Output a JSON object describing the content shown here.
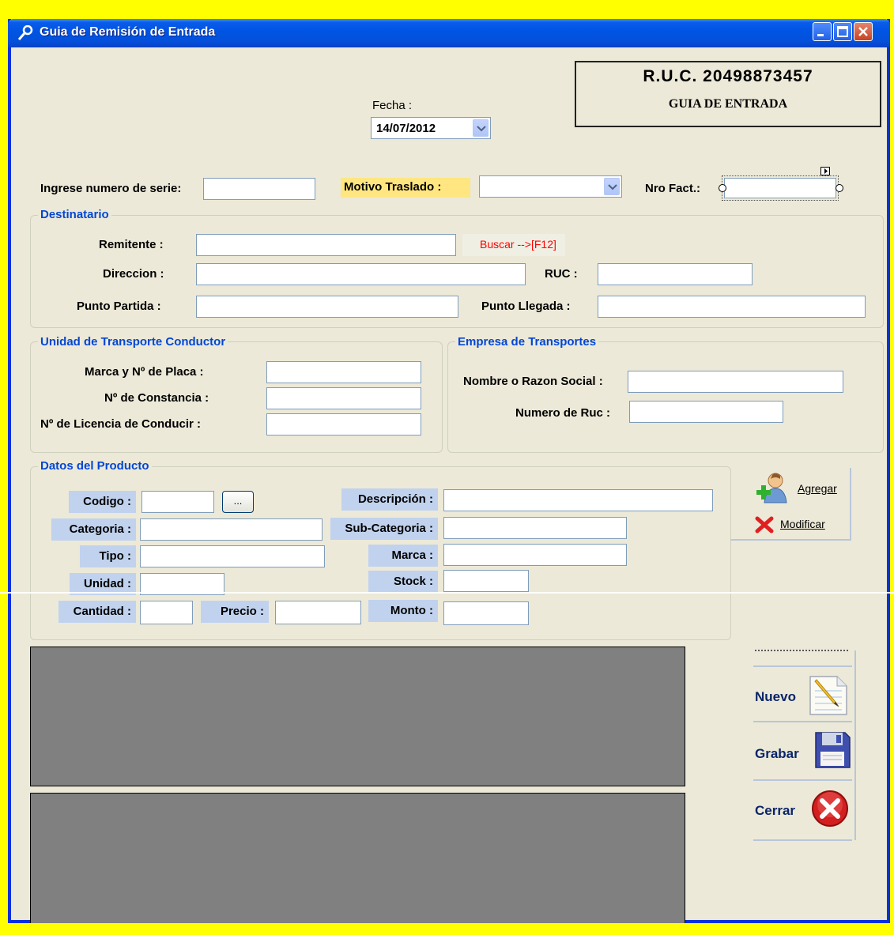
{
  "window": {
    "title": "Guia de Remisión de Entrada"
  },
  "header": {
    "ruc": "R.U.C. 20498873457",
    "doc_type": "GUIA DE ENTRADA"
  },
  "fecha": {
    "label": "Fecha :",
    "value": "14/07/2012"
  },
  "top_row": {
    "serie_label": "Ingrese numero de serie:",
    "serie_value": "",
    "motivo_label": "Motivo Traslado :",
    "motivo_value": "",
    "factura_label": "Nro Fact.:",
    "factura_value": ""
  },
  "destinatario": {
    "title": "Destinatario",
    "remitente_label": "Remitente :",
    "buscar_label": "Buscar -->[F12]",
    "direccion_label": "Direccion :",
    "ruc_label": "RUC :",
    "partida_label": "Punto Partida :",
    "llegada_label": "Punto Llegada :"
  },
  "transporte_conductor": {
    "title": "Unidad de Transporte Conductor",
    "marca_placa_label": "Marca y Nº de Placa :",
    "constancia_label": "Nº de Constancia :",
    "licencia_label": "Nº de Licencia de Conducir :"
  },
  "empresa_transportes": {
    "title": "Empresa de Transportes",
    "razon_social_label": "Nombre o Razon Social :",
    "ruc_label": "Numero de Ruc :"
  },
  "producto": {
    "title": "Datos del Producto",
    "codigo_label": "Codigo :",
    "browse_label": "...",
    "categoria_label": "Categoria :",
    "tipo_label": "Tipo :",
    "unidad_label": "Unidad :",
    "cantidad_label": "Cantidad :",
    "precio_label": "Precio :",
    "descripcion_label": "Descripción :",
    "subcategoria_label": "Sub-Categoria :",
    "marca_label": "Marca :",
    "stock_label": "Stock :",
    "monto_label": "Monto :"
  },
  "item_actions": {
    "agregar": "Agregar",
    "modificar": "Modificar"
  },
  "main_actions": {
    "nuevo": "Nuevo",
    "grabar": "Grabar",
    "cerrar": "Cerrar"
  },
  "colors": {
    "title_blue": "#0054e3",
    "group_title": "#0046d5",
    "label_highlight": "#c1d2ee",
    "motivo_highlight": "#ffe680",
    "buscar_red": "#ff0000"
  }
}
